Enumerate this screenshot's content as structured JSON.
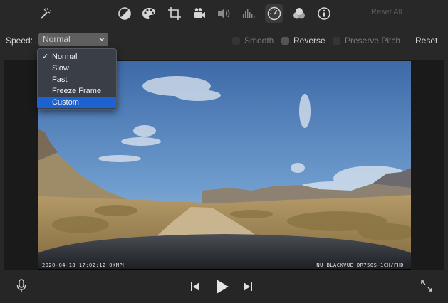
{
  "toolbar": {
    "reset_all_label": "Reset All",
    "icons": [
      "magic-wand-icon",
      "color-balance-icon",
      "color-palette-icon",
      "crop-icon",
      "stabilization-icon",
      "volume-icon",
      "equalizer-icon",
      "speed-icon",
      "filter-icon",
      "info-icon"
    ],
    "active_icon": "speed-icon"
  },
  "controls": {
    "speed_label": "Speed:",
    "speed_value": "Normal",
    "smooth_label": "Smooth",
    "reverse_label": "Reverse",
    "preserve_pitch_label": "Preserve Pitch",
    "reset_label": "Reset"
  },
  "menu": {
    "items": [
      {
        "label": "Normal",
        "checked": true,
        "highlighted": false
      },
      {
        "label": "Slow",
        "checked": false,
        "highlighted": false
      },
      {
        "label": "Fast",
        "checked": false,
        "highlighted": false
      },
      {
        "label": "Freeze Frame",
        "checked": false,
        "highlighted": false
      },
      {
        "label": "Custom",
        "checked": false,
        "highlighted": true
      }
    ],
    "check_glyph": "✓"
  },
  "video": {
    "osd_left": "2020-04-18 17:02:12  0KMPH",
    "osd_right": "NU  BLACKVUE DR750S-1CH/FHD"
  },
  "colors": {
    "accent": "#1d62d1",
    "background": "#282828"
  }
}
